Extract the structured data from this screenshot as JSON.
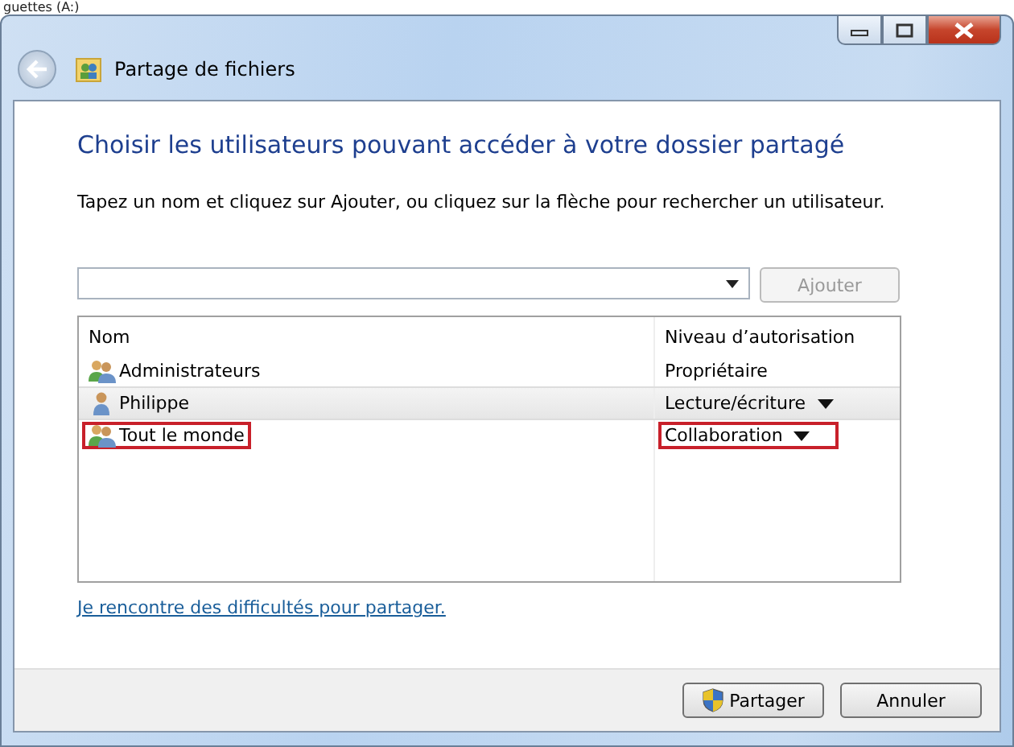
{
  "background_text": "guettes (A:)",
  "window": {
    "title": "Partage de fichiers"
  },
  "heading": "Choisir les utilisateurs pouvant accéder à votre dossier partagé",
  "instruction": "Tapez un nom et cliquez sur Ajouter, ou cliquez sur la flèche pour rechercher un utilisateur.",
  "add_button": {
    "label": "Ajouter",
    "disabled": true
  },
  "table": {
    "columns": [
      "Nom",
      "Niveau d’autorisation"
    ],
    "rows": [
      {
        "kind": "group",
        "name": "Administrateurs",
        "level": "Propriétaire",
        "dropdown": false,
        "selected": false,
        "highlighted": false
      },
      {
        "kind": "user",
        "name": "Philippe",
        "level": "Lecture/écriture",
        "dropdown": true,
        "selected": true,
        "highlighted": false
      },
      {
        "kind": "group",
        "name": "Tout le monde",
        "level": "Collaboration",
        "dropdown": true,
        "selected": false,
        "highlighted": true
      }
    ]
  },
  "help_link": "Je rencontre des difficultés pour partager.",
  "buttons": [
    {
      "label": "Partager",
      "shield": true
    },
    {
      "label": "Annuler",
      "shield": false
    }
  ]
}
